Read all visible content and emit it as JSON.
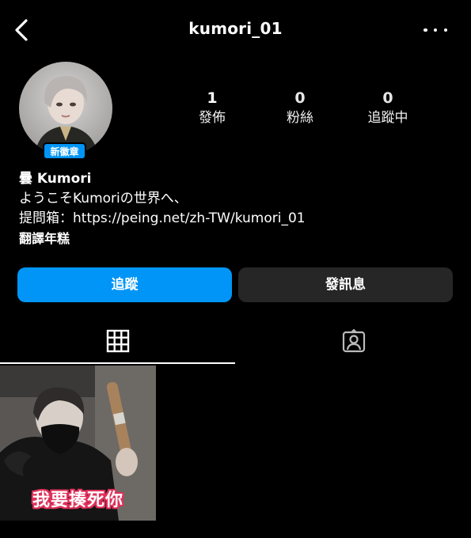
{
  "header": {
    "username": "kumori_01",
    "back_icon": "chevron-left-icon",
    "more_icon": "more-horizontal-icon"
  },
  "profile": {
    "avatar_badge": "新徽章",
    "stats": [
      {
        "value": "1",
        "label": "發佈"
      },
      {
        "value": "0",
        "label": "粉絲"
      },
      {
        "value": "0",
        "label": "追蹤中"
      }
    ]
  },
  "bio": {
    "name": "曇 Kumori",
    "line1": "ようこそKumoriの世界へ、",
    "line2": "提問箱：https://peing.net/zh-TW/kumori_01",
    "translate": "翻譯年糕"
  },
  "actions": {
    "follow_label": "追蹤",
    "message_label": "發訊息"
  },
  "tabs": [
    {
      "icon": "grid-icon",
      "selected": true
    },
    {
      "icon": "tagged-person-icon",
      "selected": false
    }
  ],
  "posts": [
    {
      "caption": "我要揍死你"
    }
  ],
  "colors": {
    "background": "#000000",
    "accent": "#0095f6",
    "secondary_button": "#262626"
  }
}
